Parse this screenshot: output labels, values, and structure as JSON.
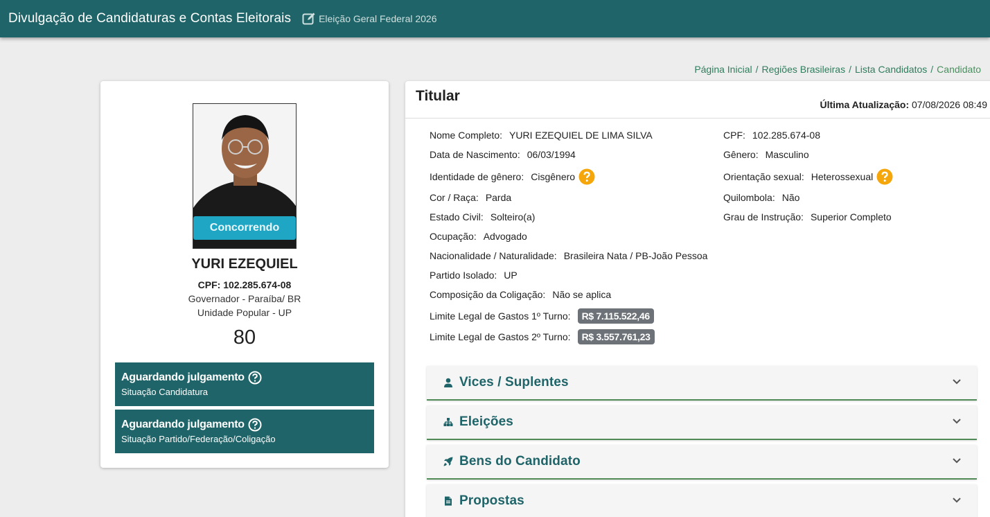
{
  "header": {
    "title": "Divulgação de Candidaturas e Contas Eleitorais",
    "election": "Eleição Geral Federal 2026",
    "icon": "edit-icon"
  },
  "breadcrumb": {
    "items": [
      "Página Inicial",
      "Regiões Brasileiras",
      "Lista Candidatos"
    ],
    "current": "Candidato"
  },
  "candidate": {
    "status": "Concorrendo",
    "name": "YURI EZEQUIEL",
    "cpf_line": "CPF: 102.285.674-08",
    "office": "Governador - Paraíba/ BR",
    "party": "Unidade Popular - UP",
    "number": "80"
  },
  "situations": [
    {
      "title": "Aguardando julgamento",
      "subtitle": "Situação Candidatura"
    },
    {
      "title": "Aguardando julgamento",
      "subtitle": "Situação Partido/Federação/Coligação"
    }
  ],
  "details": {
    "title": "Titular",
    "last_update_label": "Última Atualização:",
    "last_update_value": "07/08/2026 08:49",
    "fields": {
      "nome": {
        "label": "Nome Completo:",
        "value": "YURI EZEQUIEL DE LIMA SILVA"
      },
      "cpf": {
        "label": "CPF:",
        "value": "102.285.674-08"
      },
      "nascimento": {
        "label": "Data de Nascimento:",
        "value": "06/03/1994"
      },
      "genero": {
        "label": "Gênero:",
        "value": "Masculino"
      },
      "identidade": {
        "label": "Identidade de gênero:",
        "value": "Cisgênero"
      },
      "orientacao": {
        "label": "Orientação sexual:",
        "value": "Heterossexual"
      },
      "cor": {
        "label": "Cor / Raça:",
        "value": "Parda"
      },
      "quilombola": {
        "label": "Quilombola:",
        "value": "Não"
      },
      "estado_civil": {
        "label": "Estado Civil:",
        "value": "Solteiro(a)"
      },
      "instrucao": {
        "label": "Grau de Instrução:",
        "value": "Superior Completo"
      },
      "ocupacao": {
        "label": "Ocupação:",
        "value": "Advogado"
      },
      "nacionalidade": {
        "label": "Nacionalidade / Naturalidade:",
        "value": "Brasileira Nata / PB-João Pessoa"
      },
      "partido": {
        "label": "Partido Isolado:",
        "value": "UP"
      },
      "coligacao": {
        "label": "Composição da Coligação:",
        "value": "Não se aplica"
      },
      "limite1": {
        "label": "Limite Legal de Gastos 1º Turno:",
        "value": "R$ 7.115.522,46"
      },
      "limite2": {
        "label": "Limite Legal de Gastos 2º Turno:",
        "value": "R$ 3.557.761,23"
      }
    }
  },
  "accordions": [
    {
      "label": "Vices / Suplentes",
      "icon": "person-icon"
    },
    {
      "label": "Eleições",
      "icon": "sitemap-icon"
    },
    {
      "label": "Bens do Candidato",
      "icon": "rocket-icon"
    },
    {
      "label": "Propostas",
      "icon": "document-icon"
    }
  ],
  "colors": {
    "primary": "#1f6468",
    "status": "#1ea6c4",
    "help": "#f5a60a",
    "money_badge": "#6d7278",
    "breadcrumb": "#2e7d5c"
  }
}
